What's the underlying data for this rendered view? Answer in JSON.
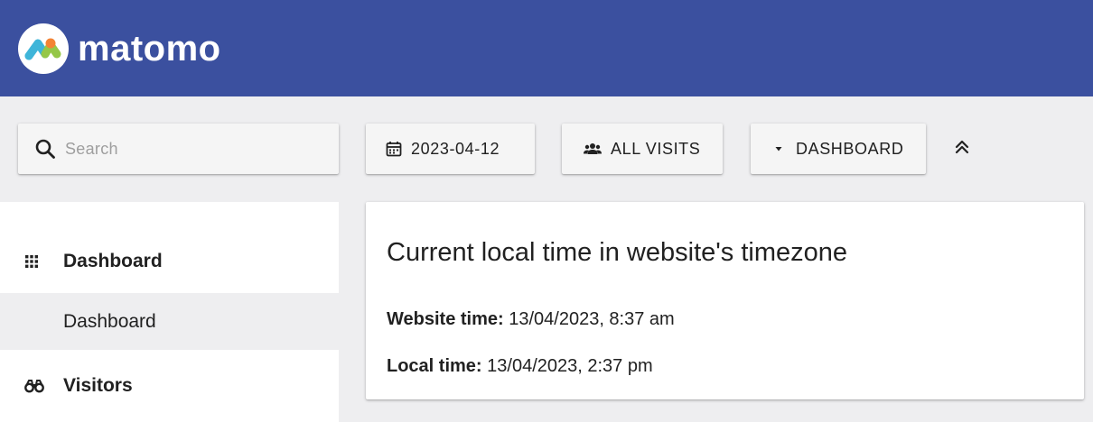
{
  "brand": {
    "name": "matomo",
    "colors": {
      "header": "#3b509f",
      "logo_blue": "#3fb5d9",
      "logo_orange": "#f38334",
      "logo_green": "#95c748"
    }
  },
  "toolbar": {
    "search_placeholder": "Search",
    "date_label": "2023-04-12",
    "segment_label": "ALL VISITS",
    "dashboard_label": "DASHBOARD",
    "icons": {
      "search": "search-icon",
      "date": "calendar-icon",
      "segment": "users-icon",
      "dashboard": "caret-down-icon",
      "collapse": "chevrons-up-icon"
    }
  },
  "sidebar": {
    "items": [
      {
        "label": "Dashboard",
        "icon": "grid-icon",
        "type": "category"
      },
      {
        "label": "Dashboard",
        "type": "subitem",
        "active": true
      },
      {
        "label": "Visitors",
        "icon": "binoculars-icon",
        "type": "category"
      }
    ]
  },
  "widget": {
    "title": "Current local time in website's timezone",
    "website_time_label": "Website time:",
    "website_time_value": "13/04/2023, 8:37 am",
    "local_time_label": "Local time:",
    "local_time_value": "13/04/2023, 2:37 pm"
  }
}
